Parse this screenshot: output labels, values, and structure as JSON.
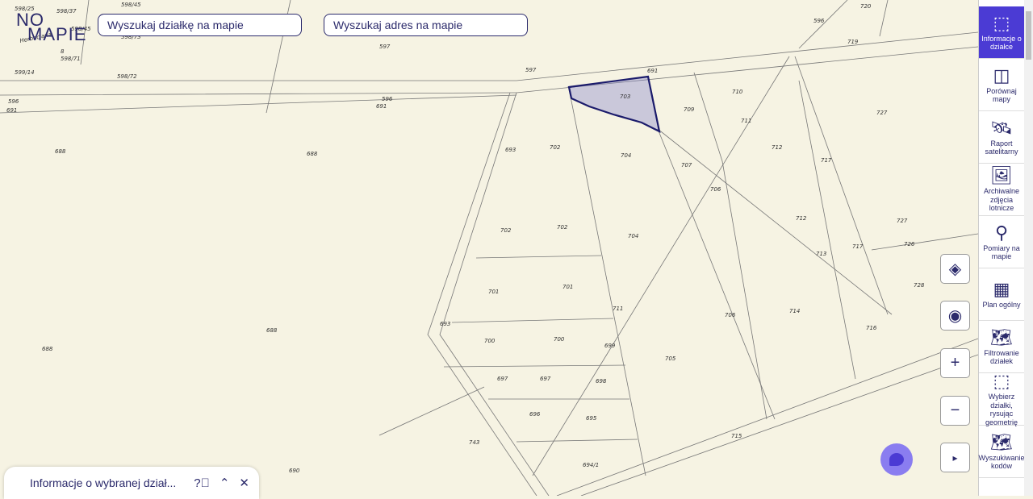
{
  "logo": {
    "line1": "NO",
    "line2": "MAPIE"
  },
  "search": {
    "parcel": "Wyszukaj działkę na mapie",
    "address": "Wyszukaj adres na mapie"
  },
  "map": {
    "street": "Herbaciana",
    "labels": [
      "598/25",
      "598/37",
      "598/45",
      "598/45",
      "598/73",
      "598/71",
      "599/14",
      "598/72",
      "596",
      "691",
      "688",
      "688",
      "688",
      "688",
      "597",
      "596",
      "691",
      "597",
      "691",
      "703",
      "709",
      "710",
      "720",
      "596",
      "719",
      "702",
      "704",
      "707",
      "711",
      "712",
      "717",
      "727",
      "693",
      "706",
      "702",
      "702",
      "704",
      "712",
      "727",
      "726",
      "717",
      "713",
      "701",
      "701",
      "711",
      "714",
      "728",
      "693",
      "700",
      "700",
      "699",
      "706",
      "716",
      "697",
      "697",
      "698",
      "705",
      "696",
      "695",
      "715",
      "743",
      "694/1",
      "690",
      "8"
    ],
    "selected_parcel": "703"
  },
  "controls": {
    "layers": "layers",
    "locate": "locate",
    "zoom_in": "+",
    "zoom_out": "−",
    "expand": "▸"
  },
  "sidebar": {
    "items": [
      {
        "label": "Informacje o działce",
        "icon": "parcel-info",
        "active": true
      },
      {
        "label": "Porównaj mapy",
        "icon": "compare"
      },
      {
        "label": "Raport satelitarny",
        "icon": "satellite"
      },
      {
        "label": "Archiwalne zdjęcia lotnicze",
        "icon": "image"
      },
      {
        "label": "Pomiary na mapie",
        "icon": "measure"
      },
      {
        "label": "Plan ogólny",
        "icon": "plan"
      },
      {
        "label": "Filtrowanie działek",
        "icon": "filter-map"
      },
      {
        "label": "Wybierz działki, rysując geometrię",
        "icon": "select-geometry"
      },
      {
        "label": "Wyszukiwanie kodów",
        "icon": "search-map"
      }
    ]
  },
  "bottom_panel": {
    "title": "Informacje o wybranej dział..."
  },
  "colors": {
    "accent": "#4b3bd4",
    "navy": "#2b2a6b",
    "map_bg": "#f6f3e3"
  }
}
